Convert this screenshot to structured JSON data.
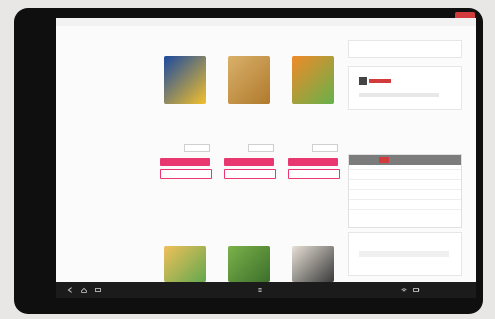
{
  "sidebar": {
    "title": "",
    "items": [
      "",
      "",
      "",
      "",
      "",
      "",
      "",
      "",
      "",
      "",
      "",
      "",
      "",
      "",
      "",
      "",
      "",
      "",
      "",
      "",
      "",
      "",
      "",
      ""
    ]
  },
  "products": [
    {
      "name": "",
      "price": "",
      "qty": "",
      "cart_label": "",
      "fav_label": ""
    },
    {
      "name": "",
      "price": "",
      "qty": "",
      "cart_label": "",
      "fav_label": ""
    },
    {
      "name": "",
      "price": "",
      "qty": "",
      "cart_label": "",
      "fav_label": ""
    }
  ],
  "right_panel": {
    "top_label": "",
    "section_title": "",
    "bottom_label": ""
  },
  "statusbar": {
    "time": ""
  },
  "colors": {
    "accent": "#e9376f",
    "badge": "#d23b3b"
  }
}
